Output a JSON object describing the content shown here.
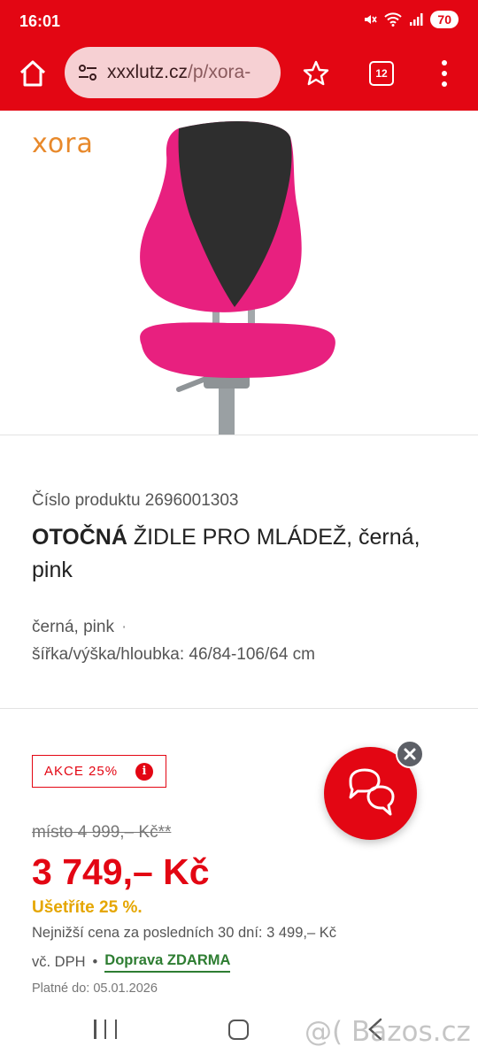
{
  "status_bar": {
    "time": "16:01",
    "battery": "70"
  },
  "browser": {
    "url_host": "xxxlutz.cz",
    "url_path": "/p/xora-",
    "tab_count": "12",
    "accent_color": "#e30613"
  },
  "product": {
    "brand": "xora",
    "product_number": "Číslo produktu 2696001303",
    "title_bold": "OTOČNÁ",
    "title_rest": " ŽIDLE PRO MLÁDEŽ, černá, pink",
    "color_spec": "černá, pink",
    "color_spec_sep": "·",
    "dimensions": "šířka/výška/hloubka: 46/84-106/64 cm",
    "image_colors": {
      "pink": "#e8207f",
      "black": "#2e2e2e",
      "frame": "#9aa0a3"
    }
  },
  "pricing": {
    "badge": "AKCE 25%",
    "badge_info": "i",
    "old_price": "místo 4 999,– Kč**",
    "price": "3 749,– Kč",
    "savings": "Ušetříte 25 %.",
    "lowest_price": "Nejnižší cena za posledních 30 dní: 3 499,– Kč",
    "vat": "vč. DPH",
    "sep": "•",
    "shipping": "Doprava ZDARMA",
    "valid_until": "Platné do: 05.01.2026",
    "colors": {
      "price": "#e30613",
      "savings": "#e5a600",
      "shipping": "#2e7d32"
    }
  },
  "watermark": "@( Bazos.cz"
}
